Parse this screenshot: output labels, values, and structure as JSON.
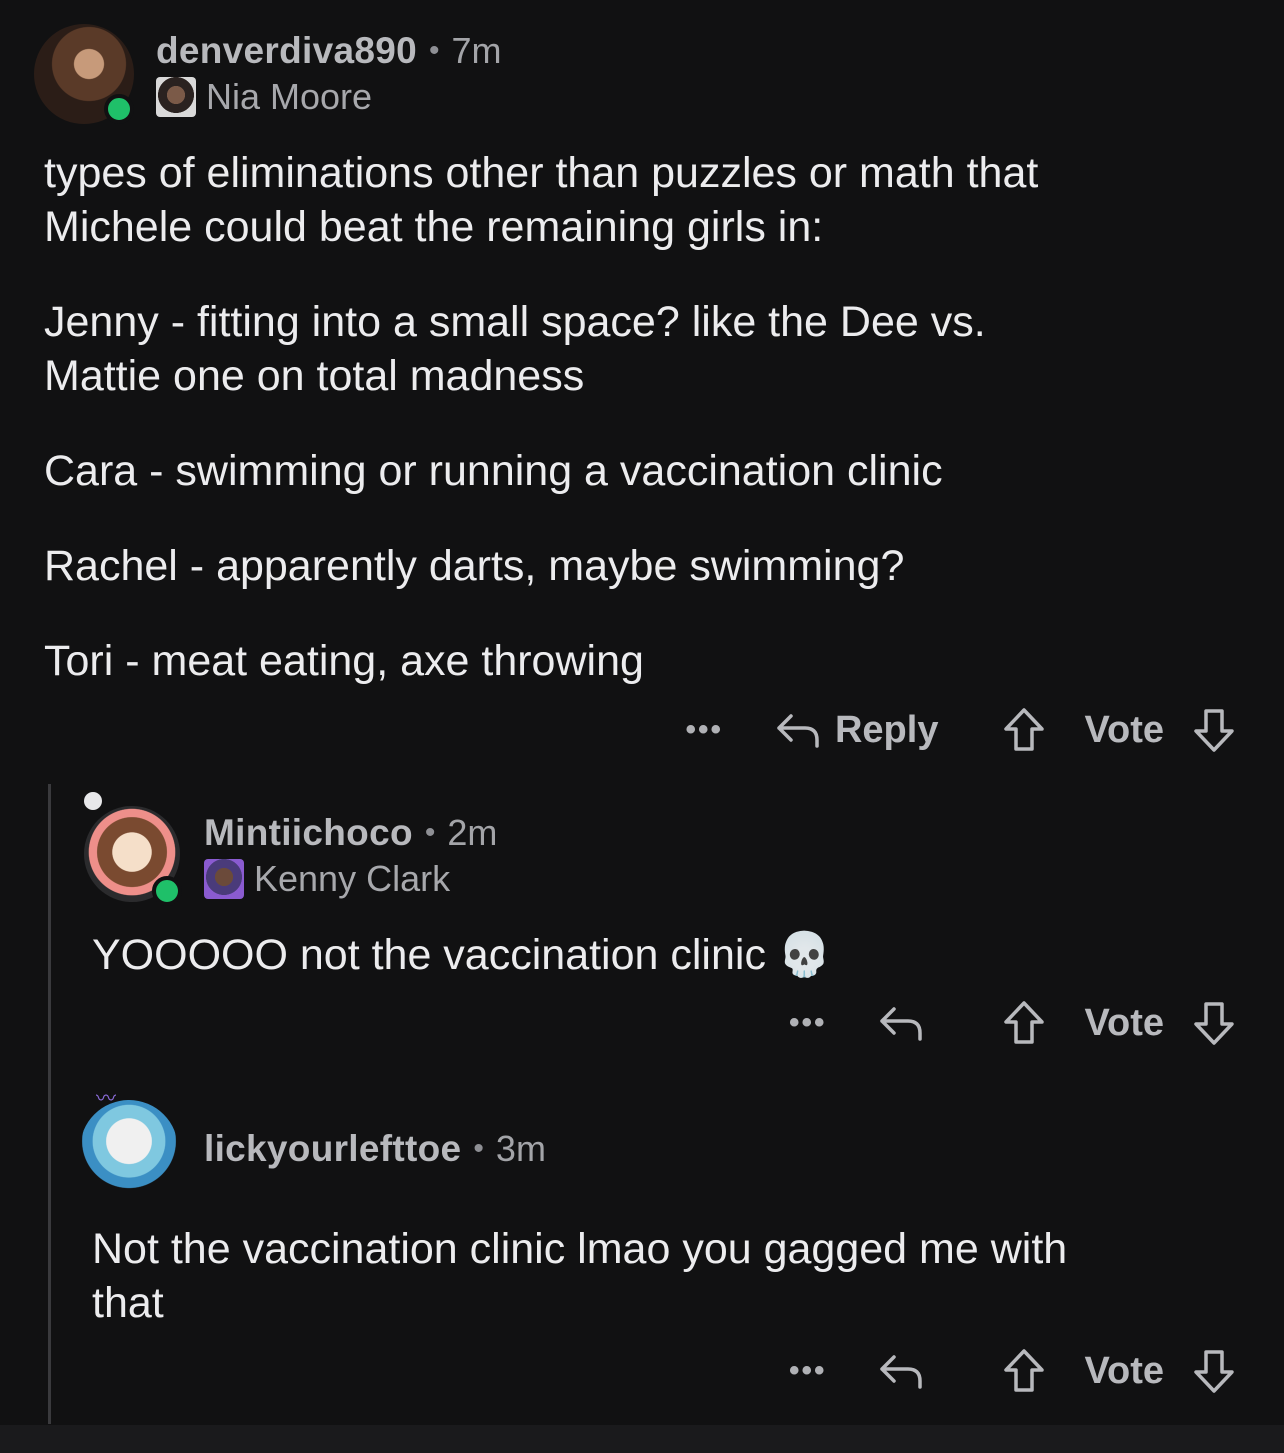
{
  "colors": {
    "background": "#111112",
    "online": "#1fc069",
    "thread_line": "#3a3a3d"
  },
  "comments": [
    {
      "username": "denverdiva890",
      "time": "7m",
      "flair": "Nia Moore",
      "paragraphs": [
        "types of eliminations other than puzzles or math that\nMichele could beat the remaining girls in:",
        "Jenny - fitting into a small space? like the Dee vs.\nMattie one on total madness",
        "Cara - swimming or running a vaccination clinic",
        "Rachel - apparently darts, maybe swimming?",
        "Tori - meat eating, axe throwing"
      ],
      "actions": {
        "more": "•••",
        "reply": "Reply",
        "vote": "Vote"
      }
    },
    {
      "username": "Mintiichoco",
      "time": "2m",
      "flair": "Kenny Clark",
      "text": "YOOOOO not the vaccination clinic 💀",
      "actions": {
        "more": "•••",
        "vote": "Vote"
      }
    },
    {
      "username": "lickyourlefttoe",
      "time": "3m",
      "text": "Not the vaccination clinic lmao you gagged me with\nthat",
      "actions": {
        "more": "•••",
        "vote": "Vote"
      }
    }
  ]
}
